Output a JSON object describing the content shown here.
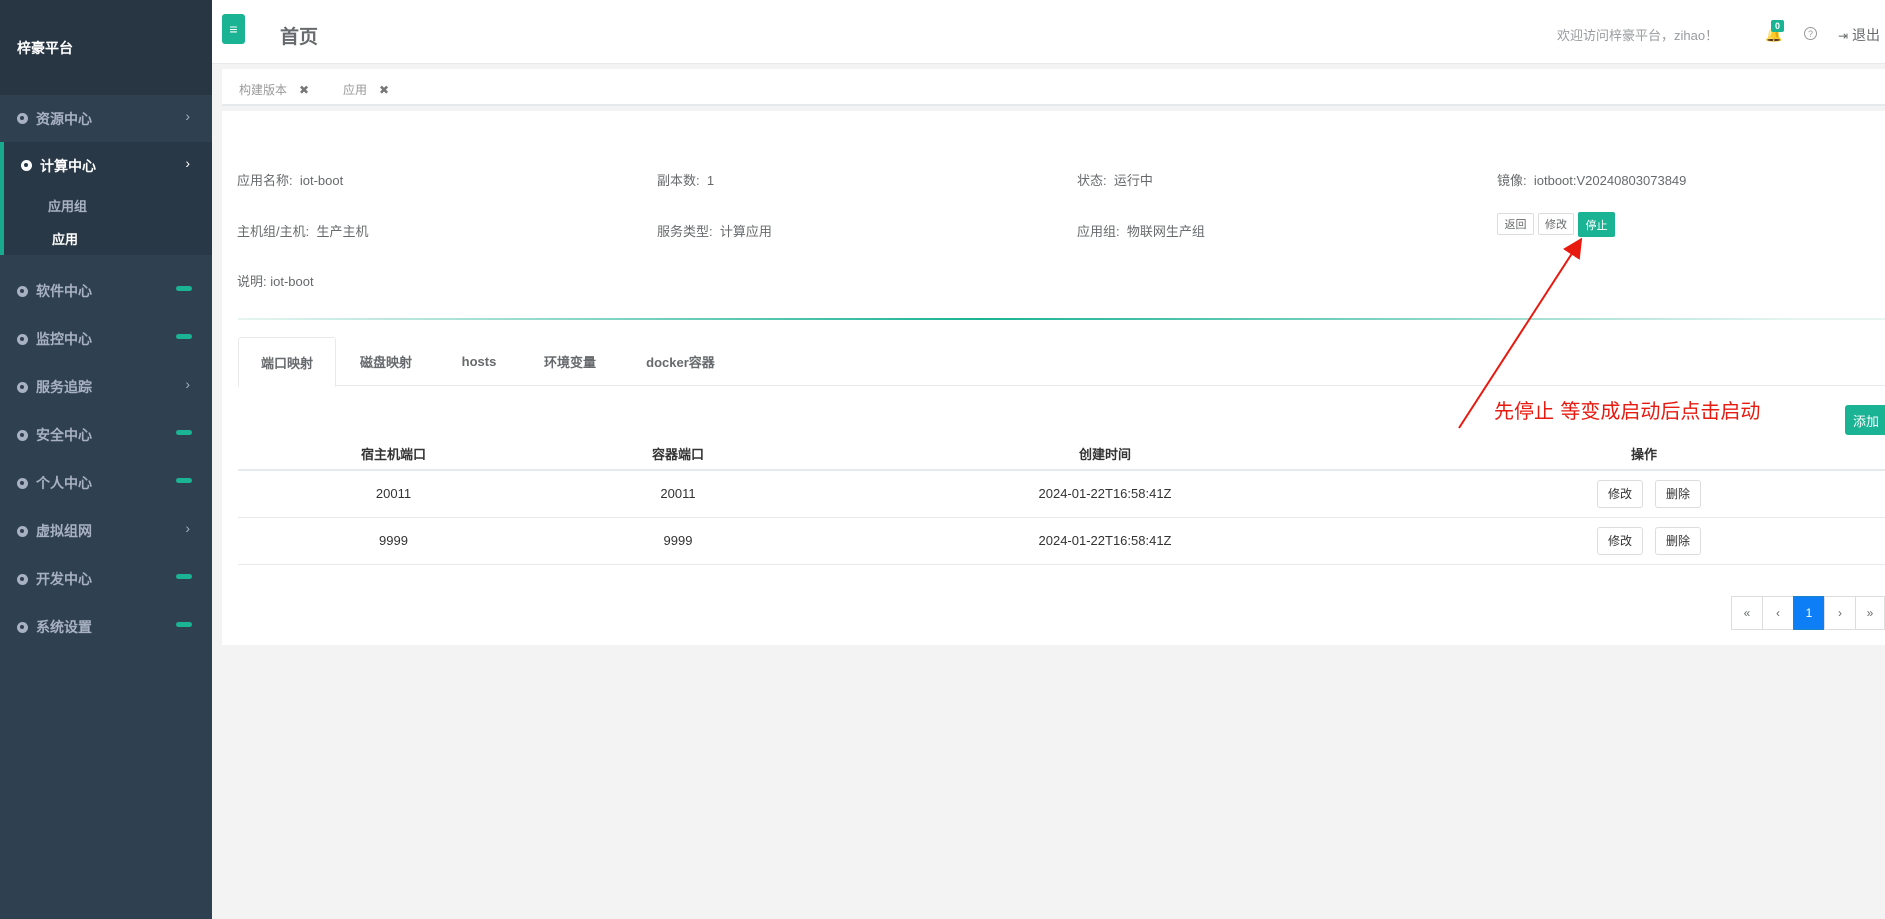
{
  "sidebar": {
    "brand": "梓豪平台",
    "items": [
      {
        "label": "资源中心"
      },
      {
        "label": "计算中心"
      },
      {
        "label": "软件中心"
      },
      {
        "label": "监控中心"
      },
      {
        "label": "服务追踪"
      },
      {
        "label": "安全中心"
      },
      {
        "label": "个人中心"
      },
      {
        "label": "虚拟组网"
      },
      {
        "label": "开发中心"
      },
      {
        "label": "系统设置"
      }
    ],
    "sub_items": [
      "应用组",
      "应用"
    ]
  },
  "header": {
    "title": "首页",
    "welcome": "欢迎访问梓豪平台，zihao！",
    "notification_count": "0",
    "logout": "退出"
  },
  "page_tabs": [
    "构建版本",
    "应用"
  ],
  "app": {
    "name_label": "应用名称:",
    "name": "iot-boot",
    "replicas_label": "副本数:",
    "replicas": "1",
    "status_label": "状态:",
    "status": "运行中",
    "image_label": "镜像:",
    "image": "iotboot:V20240803073849",
    "host_label": "主机组/主机:",
    "host": "生产主机",
    "service_type_label": "服务类型:",
    "service_type": "计算应用",
    "group_label": "应用组:",
    "group": "物联网生产组",
    "desc_label": "说明:",
    "desc": "iot-boot"
  },
  "actions": {
    "back": "返回",
    "edit": "修改",
    "stop": "停止"
  },
  "detail_tabs": [
    "端口映射",
    "磁盘映射",
    "hosts",
    "环境变量",
    "docker容器"
  ],
  "annotation": "先停止 等变成启动后点击启动",
  "add_button": "添加",
  "table": {
    "headers": [
      "宿主机端口",
      "容器端口",
      "创建时间",
      "操作"
    ],
    "rows": [
      {
        "host_port": "20011",
        "container_port": "20011",
        "created": "2024-01-22T16:58:41Z"
      },
      {
        "host_port": "9999",
        "container_port": "9999",
        "created": "2024-01-22T16:58:41Z"
      }
    ],
    "row_edit": "修改",
    "row_delete": "删除"
  },
  "pagination": {
    "first": "«",
    "prev": "‹",
    "current": "1",
    "next": "›",
    "last": "»"
  },
  "colors": {
    "accent": "#1ab394",
    "sidebar": "#2f4050",
    "annotation": "#e8190f",
    "page_active": "#0d7ef5"
  }
}
